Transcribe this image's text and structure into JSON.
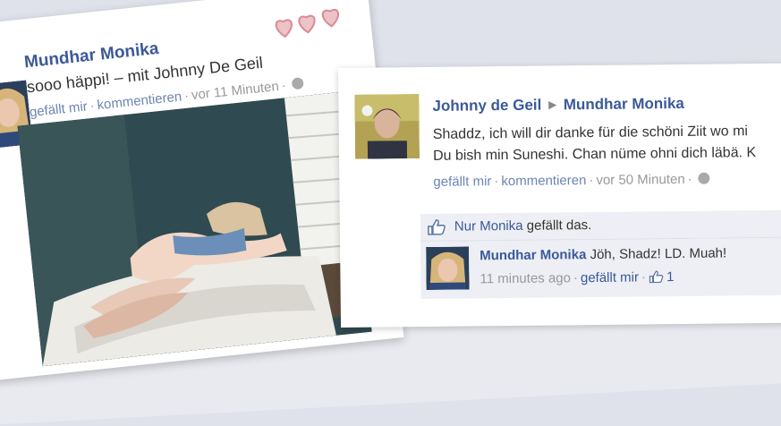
{
  "post1": {
    "author": "Mundhar Monika",
    "status_text": "sooo häppi! – mit Johnny De Geil",
    "like_label": "gefällt mir",
    "comment_label": "kommentieren",
    "time": "vor 11 Minuten",
    "separator": "·",
    "icons": [
      "heart-icon",
      "heart-icon",
      "heart-icon",
      "globe-icon"
    ]
  },
  "post2": {
    "author": "Johnny de Geil",
    "target": "Mundhar Monika",
    "message_line1": "Shaddz, ich will dir danke für die schöni Ziit wo mi",
    "message_line2": "Du bish min Suneshi. Chan nüme ohni dich läbä. K",
    "like_label": "gefällt mir",
    "comment_label": "kommentieren",
    "time": "vor 50 Minuten",
    "separator": "·",
    "likes_link": "Nur Monika",
    "likes_suffix": "gefällt das.",
    "comment": {
      "author": "Mundhar Monika",
      "text": "Jöh, Shadz! LD. Muah!",
      "time": "11 minutes ago",
      "like_label": "gefällt mir",
      "like_count": "1"
    }
  },
  "colors": {
    "link": "#3b5998",
    "meta": "#6d84b4",
    "muted": "#999999",
    "heart": "#e8a0a8",
    "likes_bg": "#edeff4"
  }
}
